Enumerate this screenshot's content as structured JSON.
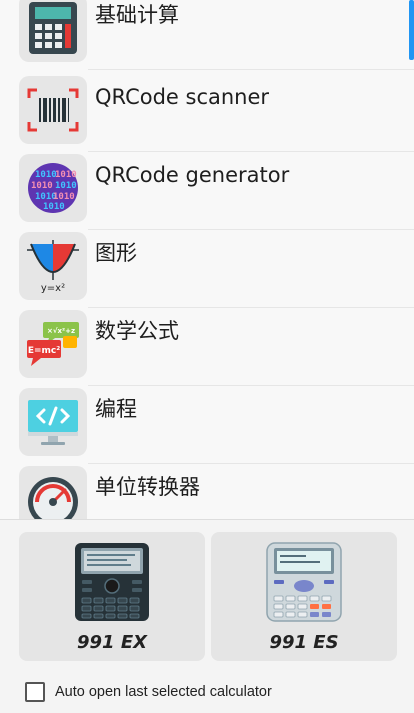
{
  "menu": {
    "items": [
      {
        "label": "基础计算",
        "icon": "calculator-icon"
      },
      {
        "label": "QRCode scanner",
        "icon": "barcode-scanner-icon"
      },
      {
        "label": "QRCode generator",
        "icon": "binary-globe-icon"
      },
      {
        "label": "图形",
        "icon": "parabola-graph-icon"
      },
      {
        "label": "数学公式",
        "icon": "formula-speech-bubbles-icon"
      },
      {
        "label": "编程",
        "icon": "code-monitor-icon"
      },
      {
        "label": "单位转换器",
        "icon": "speedometer-icon"
      }
    ]
  },
  "icon_texts": {
    "graph_formula": "y=x²",
    "formula_main": "E=mc²",
    "formula_small": "×√x²+z",
    "generator_bits": "1010"
  },
  "calculators": [
    {
      "name": "991 EX"
    },
    {
      "name": "991 ES"
    }
  ],
  "auto_open": {
    "label": "Auto open last selected calculator",
    "checked": false
  },
  "colors": {
    "accent": "#2196f3",
    "tile_background": "#e6e6e6"
  }
}
